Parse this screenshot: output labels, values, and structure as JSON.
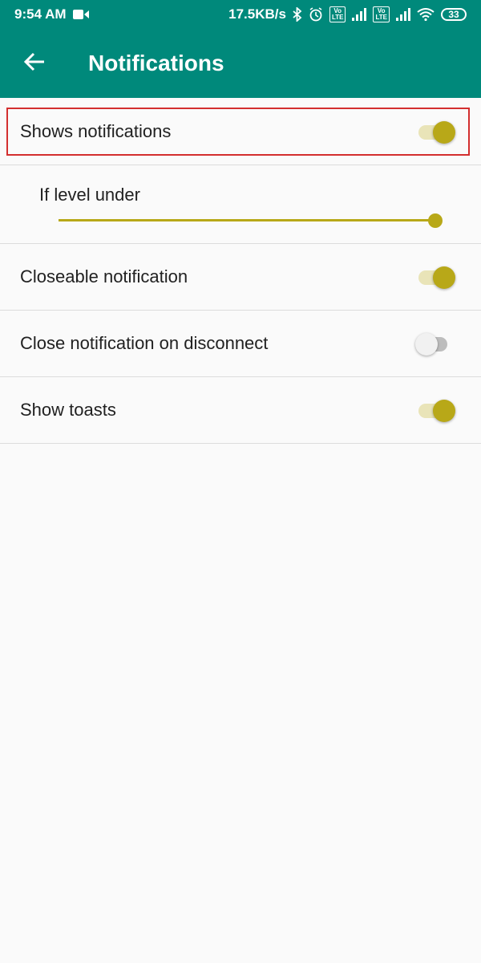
{
  "status_bar": {
    "time": "9:54 AM",
    "speed": "17.5KB/s",
    "volte_label": "Vo\nLTE",
    "battery": "33"
  },
  "header": {
    "title": "Notifications"
  },
  "prefs": {
    "shows_notifications": {
      "label": "Shows notifications",
      "enabled": true
    },
    "level_slider": {
      "label": "If level under",
      "value_fraction": 1.0
    },
    "closeable": {
      "label": "Closeable notification",
      "enabled": true
    },
    "close_on_disconnect": {
      "label": "Close notification on disconnect",
      "enabled": false
    },
    "show_toasts": {
      "label": "Show toasts",
      "enabled": true
    }
  },
  "colors": {
    "primary": "#00897b",
    "accent": "#b8a818",
    "highlight": "#d32f2f"
  }
}
